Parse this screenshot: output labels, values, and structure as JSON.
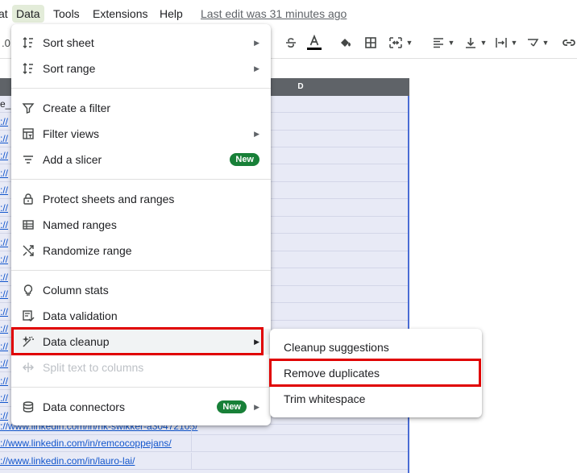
{
  "menubar": {
    "items": [
      {
        "label": "at",
        "active": false
      },
      {
        "label": "Data",
        "active": true
      },
      {
        "label": "Tools",
        "active": false
      },
      {
        "label": "Extensions",
        "active": false
      },
      {
        "label": "Help",
        "active": false
      }
    ],
    "last_edit": "Last edit was 31 minutes ago"
  },
  "toolbar": {
    "left_fragment": ".0",
    "icons": [
      "strikethrough-icon",
      "text-color-icon",
      "fill-color-icon",
      "borders-icon",
      "merge-cells-icon",
      "horizontal-align-icon",
      "vertical-align-icon",
      "text-wrapping-icon",
      "text-rotation-icon",
      "insert-link-icon"
    ]
  },
  "sheet": {
    "column_header": "D",
    "row_fragment_top": "e_",
    "rows": [
      "://",
      "://",
      "://",
      "://",
      "://",
      "://",
      "://",
      "://",
      "://",
      "://",
      "://",
      "://",
      "://",
      "://",
      "://",
      "://",
      "://",
      "://",
      "://www.linkedin.com/in/rik-swikker-a30472105/",
      "://www.linkedin.com/in/remcocoppejans/",
      "://www.linkedin.com/in/lauro-lai/"
    ]
  },
  "data_menu": {
    "sections": [
      [
        {
          "label": "Sort sheet",
          "icon": "sort-icon",
          "submenu": true
        },
        {
          "label": "Sort range",
          "icon": "sort-icon",
          "submenu": true
        }
      ],
      [
        {
          "label": "Create a filter",
          "icon": "filter-icon"
        },
        {
          "label": "Filter views",
          "icon": "filter-views-icon",
          "submenu": true
        },
        {
          "label": "Add a slicer",
          "icon": "slicer-icon",
          "badge": "New"
        }
      ],
      [
        {
          "label": "Protect sheets and ranges",
          "icon": "lock-icon"
        },
        {
          "label": "Named ranges",
          "icon": "named-ranges-icon"
        },
        {
          "label": "Randomize range",
          "icon": "shuffle-icon"
        }
      ],
      [
        {
          "label": "Column stats",
          "icon": "lightbulb-icon"
        },
        {
          "label": "Data validation",
          "icon": "data-validation-icon"
        },
        {
          "label": "Data cleanup",
          "icon": "magic-wand-icon",
          "submenu": true,
          "highlight": true
        },
        {
          "label": "Split text to columns",
          "icon": "split-icon",
          "disabled": true
        }
      ],
      [
        {
          "label": "Data connectors",
          "icon": "database-icon",
          "badge": "New",
          "submenu": true
        }
      ]
    ]
  },
  "cleanup_submenu": {
    "items": [
      "Cleanup suggestions",
      "Remove duplicates",
      "Trim whitespace"
    ]
  },
  "colors": {
    "highlight_box": "#e00000",
    "new_badge": "#188038",
    "link": "#1155cc",
    "selection_fill": "#e8eaf6"
  }
}
